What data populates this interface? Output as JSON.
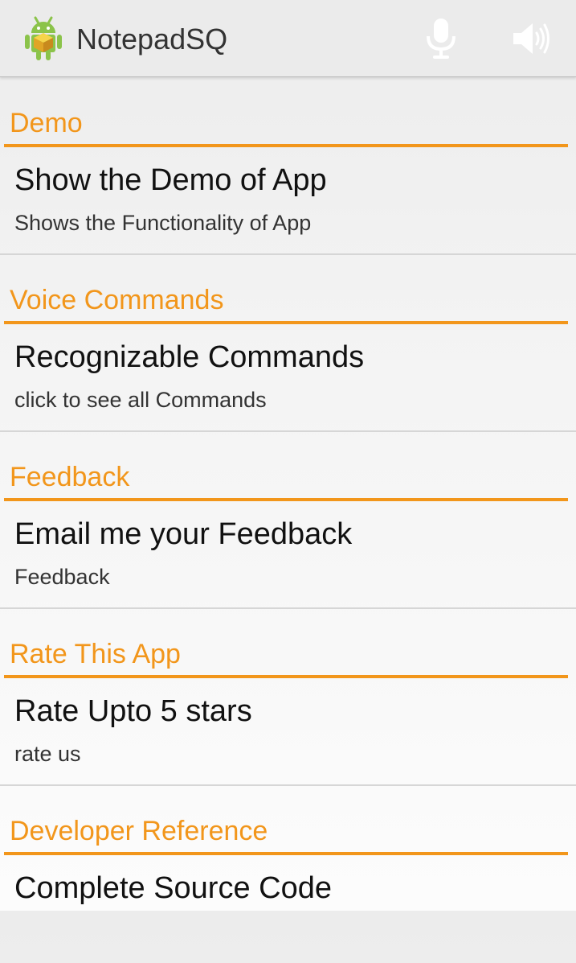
{
  "app": {
    "title": "NotepadSQ",
    "icon": "android-app-icon"
  },
  "actions": [
    {
      "icon": "microphone-icon",
      "color": "#ffffff"
    },
    {
      "icon": "speaker-icon",
      "color": "#ffffff"
    }
  ],
  "theme": {
    "accent": "#f2961b",
    "divider": "#d6d6d6"
  },
  "categories": [
    {
      "title": "Demo",
      "item": {
        "title": "Show the Demo of App",
        "summary": "Shows the Functionality of App"
      }
    },
    {
      "title": "Voice Commands",
      "item": {
        "title": "Recognizable Commands",
        "summary": "click to see all Commands"
      }
    },
    {
      "title": "Feedback",
      "item": {
        "title": "Email me your Feedback",
        "summary": "Feedback"
      }
    },
    {
      "title": "Rate This App",
      "item": {
        "title": "Rate Upto 5 stars",
        "summary": "rate us"
      }
    },
    {
      "title": "Developer Reference",
      "item": {
        "title": "Complete Source Code",
        "summary": ""
      }
    }
  ]
}
